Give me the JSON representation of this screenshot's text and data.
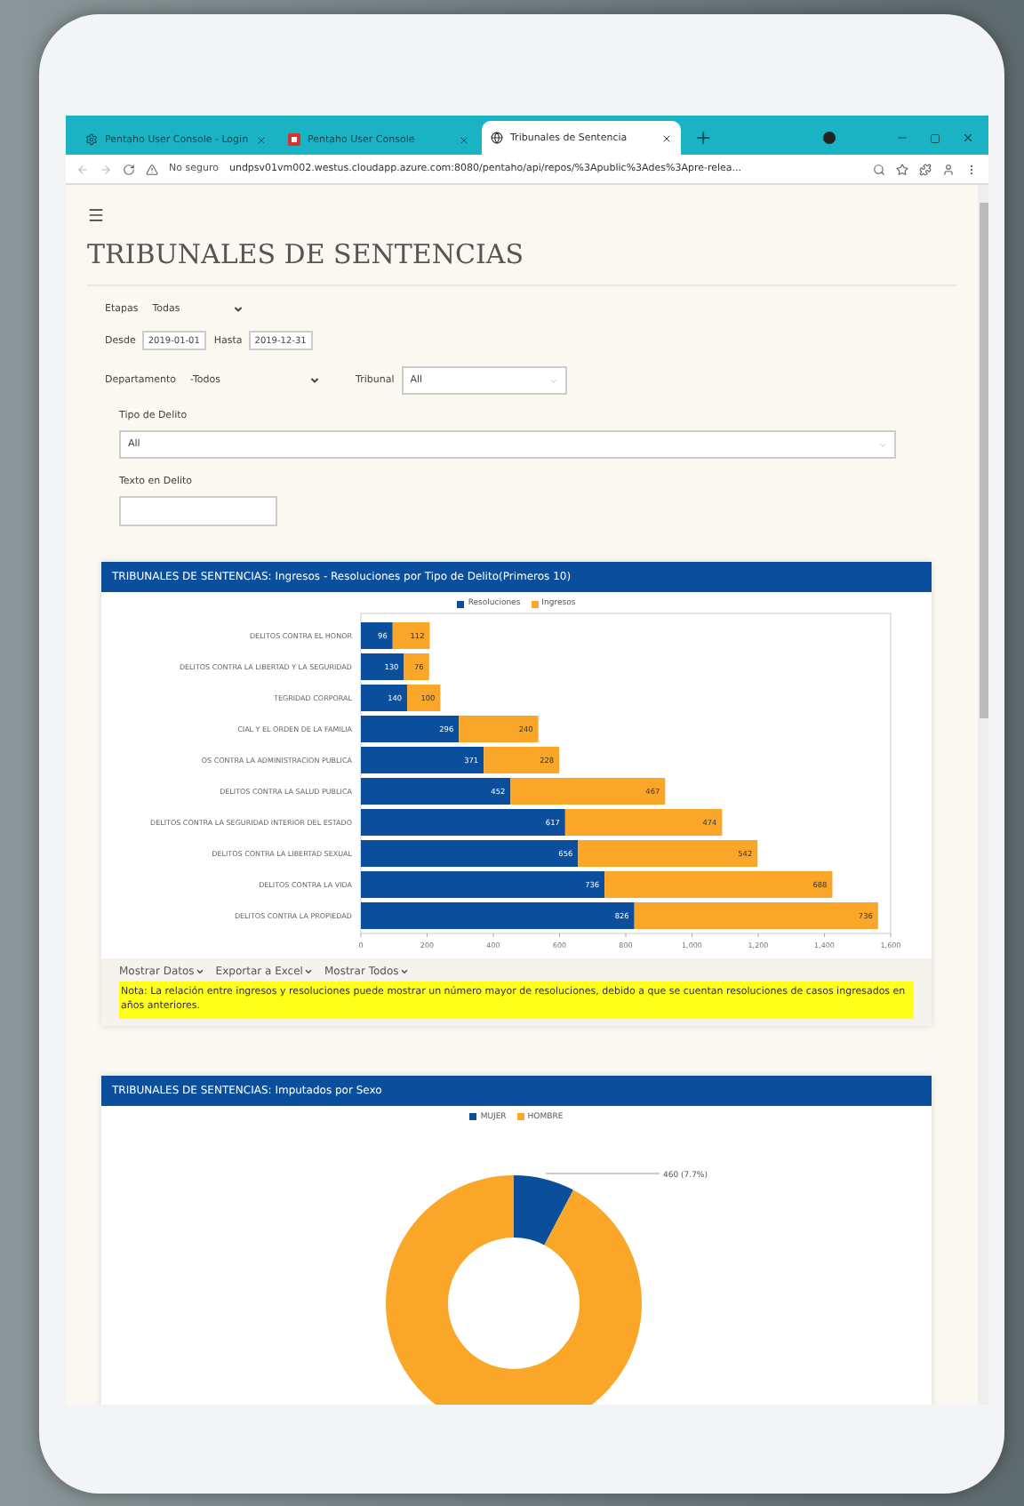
{
  "browser": {
    "tabs": [
      {
        "kind": "gear",
        "title": "Pentaho User Console - Login",
        "selected": false
      },
      {
        "kind": "logo",
        "title": "Pentaho User Console",
        "selected": false
      },
      {
        "kind": "globe",
        "title": "Tribunales de Sentencia",
        "selected": true
      }
    ],
    "new_tab": "+",
    "security": "No seguro",
    "url": "undpsv01vm002.westus.cloudapp.azure.com:8080/pentaho/api/repos/%3Apublic%3Ades%3Apre-relea..."
  },
  "page": {
    "title": "TRIBUNALES DE SENTENCIAS",
    "etapas": {
      "label": "Etapas",
      "value": "Todas"
    },
    "desde": {
      "label": "Desde",
      "value": "2019-01-01"
    },
    "hasta": {
      "label": "Hasta",
      "value": "2019-12-31"
    },
    "departamento": {
      "label": "Departamento",
      "value": "-Todos"
    },
    "tribunal": {
      "label": "Tribunal",
      "value": "All"
    },
    "tipo_delito": {
      "label": "Tipo de Delito",
      "value": "All"
    },
    "texto_delito": {
      "label": "Texto en Delito"
    }
  },
  "bar_card": {
    "title": "TRIBUNALES DE SENTENCIAS: Ingresos - Resoluciones por Tipo de Delito(Primeros 10)",
    "chart_data": {
      "type": "bar",
      "orientation": "horizontal",
      "stacked": true,
      "data_labels": true,
      "categories": [
        "DELITOS CONTRA EL HONOR",
        "DELITOS CONTRA LA LIBERTAD Y LA SEGURIDAD",
        "TEGRIDAD CORPORAL",
        "CIAL Y EL ORDEN DE LA FAMILIA",
        "OS CONTRA LA ADMINISTRACION PUBLICA",
        "DELITOS CONTRA LA SALUD PUBLICA",
        "DELITOS CONTRA LA SEGURIDAD INTERIOR DEL ESTADO",
        "DELITOS CONTRA LA LIBERTAD SEXUAL",
        "DELITOS CONTRA LA VIDA",
        "DELITOS CONTRA LA PROPIEDAD"
      ],
      "series": [
        {
          "name": "Resoluciones",
          "color": "#0b4f9c",
          "values": [
            96,
            130,
            140,
            296,
            371,
            452,
            617,
            656,
            736,
            826
          ]
        },
        {
          "name": "Ingresos",
          "color": "#f9a629",
          "values": [
            112,
            76,
            100,
            240,
            228,
            467,
            474,
            542,
            688,
            736
          ]
        }
      ],
      "xlim": [
        0,
        1600
      ],
      "xticks": [
        0,
        200,
        400,
        600,
        800,
        {
          "value": 1000,
          "label": "1,000"
        },
        {
          "value": 1200,
          "label": "1,200"
        },
        {
          "value": 1400,
          "label": "1,400"
        },
        {
          "value": 1600,
          "label": "1,600"
        }
      ]
    },
    "menus": [
      "Mostrar Datos",
      "Exportar a Excel",
      "Mostrar Todos"
    ],
    "note": "Nota: La relación entre ingresos y resoluciones puede mostrar un número mayor de resoluciones, debido a que se cuentan resoluciones de casos ingresados en años anteriores."
  },
  "donut_card": {
    "title": "TRIBUNALES DE SENTENCIAS: Imputados por Sexo",
    "chart_data": {
      "type": "donut",
      "categories": [
        "MUJER",
        "HOMBRE"
      ],
      "values": [
        7.7,
        92.3
      ],
      "colors": [
        "#0b4f9c",
        "#f9a629"
      ],
      "value_labels": [
        "460 (7.7%)",
        null
      ]
    }
  }
}
